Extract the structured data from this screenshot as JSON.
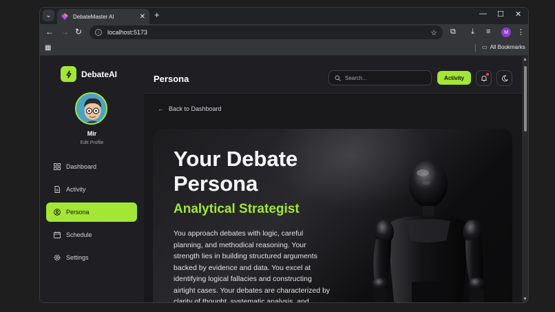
{
  "browser": {
    "tab_title": "DebateMaster AI",
    "url": "localhost:5173",
    "bookmarks_label": "All Bookmarks",
    "profile_initial": "M"
  },
  "brand": {
    "name": "DebateAI"
  },
  "user": {
    "name": "Mir",
    "edit_label": "Edit Profile"
  },
  "sidebar": {
    "items": [
      {
        "label": "Dashboard",
        "icon": "grid-icon",
        "active": false
      },
      {
        "label": "Activity",
        "icon": "document-icon",
        "active": false
      },
      {
        "label": "Persona",
        "icon": "user-circle-icon",
        "active": true
      },
      {
        "label": "Schedule",
        "icon": "calendar-icon",
        "active": false
      },
      {
        "label": "Settings",
        "icon": "gear-icon",
        "active": false
      }
    ]
  },
  "header": {
    "title": "Persona",
    "search_placeholder": "Search...",
    "activity_label": "Activity"
  },
  "content": {
    "back_label": "Back to Dashboard",
    "hero_title": "Your Debate Persona",
    "persona_name": "Analytical Strategist",
    "description": "You approach debates with logic, careful planning, and methodical reasoning. Your strength lies in building structured arguments backed by evidence and data. You excel at identifying logical fallacies and constructing airtight cases. Your debates are characterized by clarity of thought, systematic analysis, and"
  },
  "colors": {
    "accent": "#a3e635",
    "background": "#18181b",
    "sidebar": "#1f1f23"
  }
}
